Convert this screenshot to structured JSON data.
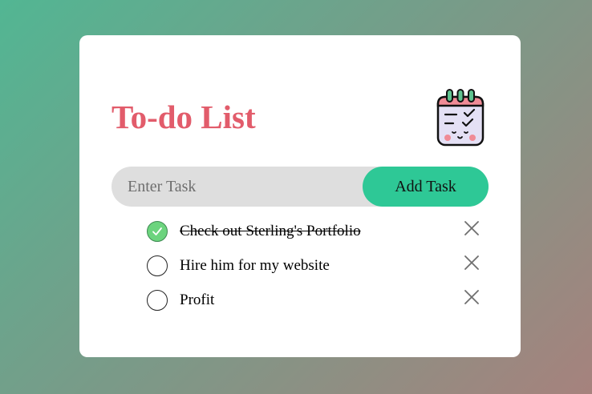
{
  "app": {
    "title": "To-do List",
    "icon": "checklist-calendar-icon"
  },
  "input": {
    "placeholder": "Enter Task",
    "value": ""
  },
  "add_button": {
    "label": "Add Task"
  },
  "tasks": [
    {
      "text": "Check out Sterling's Portfolio",
      "done": true
    },
    {
      "text": "Hire him for my website",
      "done": false
    },
    {
      "text": "Profit",
      "done": false
    }
  ],
  "colors": {
    "title": "#e25c6b",
    "accent": "#2ec896",
    "checked": "#6cd47e",
    "input_bg": "#dedede"
  }
}
